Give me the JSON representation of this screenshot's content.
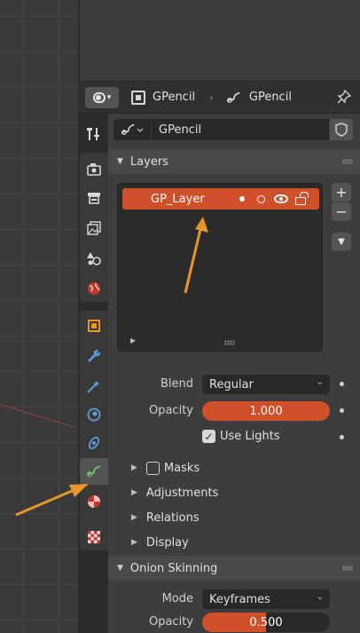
{
  "header": {
    "object_name": "GPencil",
    "data_name": "GPencil"
  },
  "datablock": {
    "name": "GPencil"
  },
  "layers_panel": {
    "title": "Layers",
    "layers": [
      {
        "name": "GP_Layer",
        "active": true
      }
    ],
    "add_label": "+",
    "remove_label": "−"
  },
  "layer_props": {
    "blend_label": "Blend",
    "blend_value": "Regular",
    "opacity_label": "Opacity",
    "opacity_value": "1.000",
    "use_lights_label": "Use Lights",
    "use_lights_checked": true
  },
  "subpanels": {
    "masks": "Masks",
    "adjustments": "Adjustments",
    "relations": "Relations",
    "display": "Display"
  },
  "onion_skinning": {
    "title": "Onion Skinning",
    "mode_label": "Mode",
    "mode_value": "Keyframes",
    "opacity_label": "Opacity",
    "opacity_value": "0.500",
    "opacity_fraction": 0.5
  },
  "colors": {
    "accent": "#d0502b",
    "annotation_arrow": "#e8962a",
    "panel_bg": "#3d3d3d",
    "field_bg": "#282828"
  },
  "tabs": [
    "tool-tab",
    "render-tab",
    "output-tab",
    "view-layer-tab",
    "scene-tab",
    "world-tab",
    "object-tab",
    "modifiers-tab",
    "shader-effects-tab",
    "physics-tab",
    "constraints-tab",
    "object-data-tab",
    "material-tab",
    "texture-tab"
  ]
}
